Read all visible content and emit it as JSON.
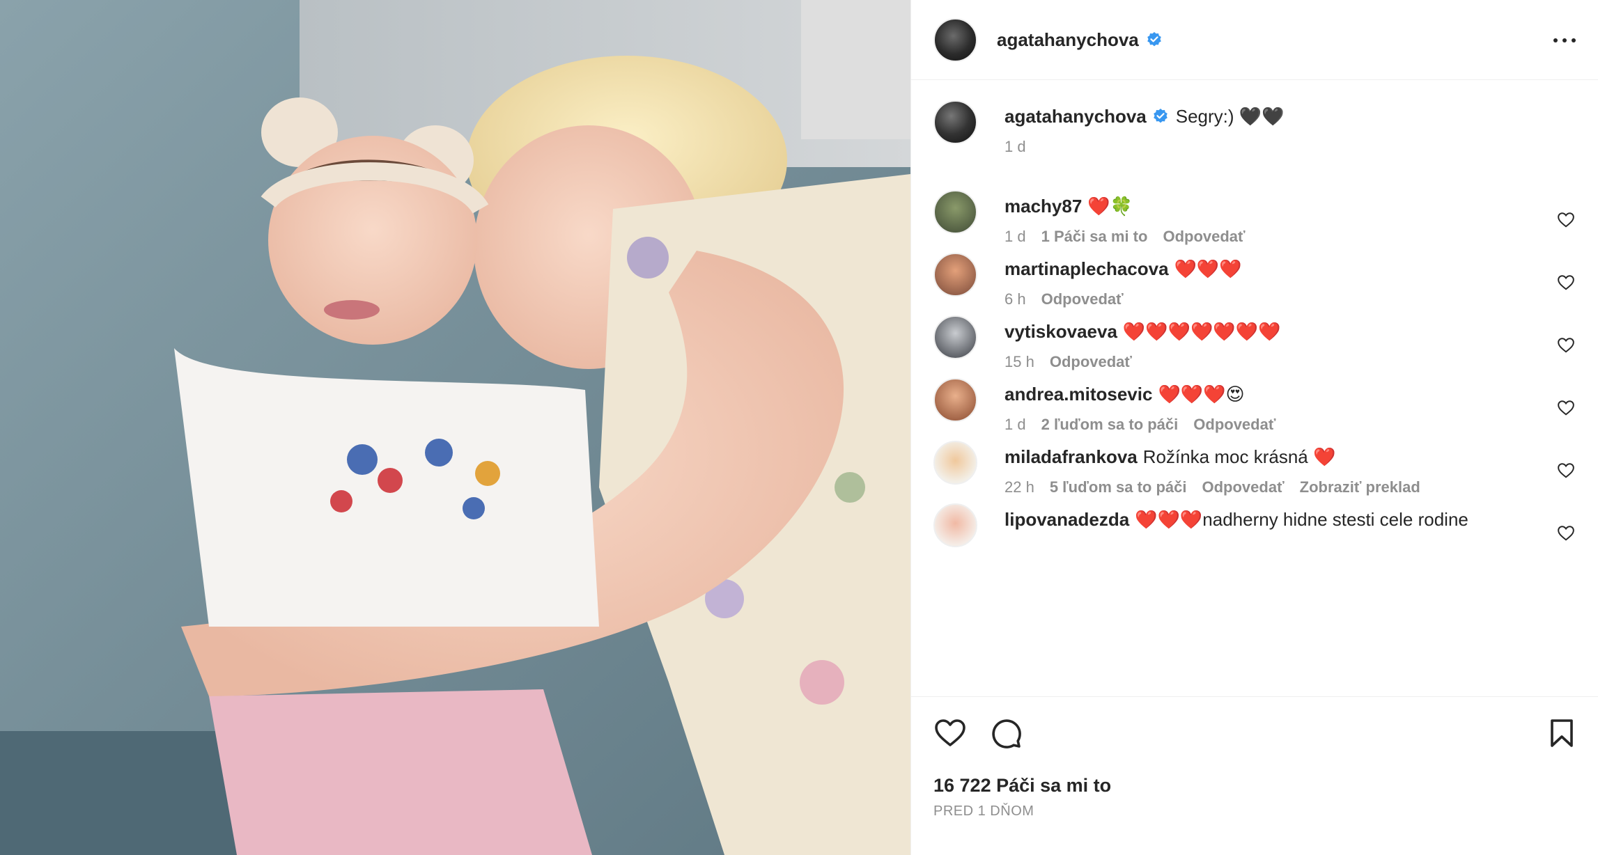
{
  "post": {
    "author": "agatahanychova",
    "more_icon": "more-options-icon"
  },
  "caption": {
    "username": "agatahanychova",
    "text": "Segry:) 🖤🖤",
    "time": "1 d"
  },
  "comments": [
    {
      "username": "machy87",
      "text": "❤️🍀",
      "time": "1 d",
      "likes": "1 Páči sa mi to",
      "reply": "Odpovedať",
      "translate": ""
    },
    {
      "username": "martinaplechacova",
      "text": "❤️❤️❤️",
      "time": "6 h",
      "likes": "",
      "reply": "Odpovedať",
      "translate": ""
    },
    {
      "username": "vytiskovaeva",
      "text": "❤️❤️❤️❤️❤️❤️❤️",
      "time": "15 h",
      "likes": "",
      "reply": "Odpovedať",
      "translate": ""
    },
    {
      "username": "andrea.mitosevic",
      "text": "❤️❤️❤️😍",
      "time": "1 d",
      "likes": "2 ľuďom sa to páči",
      "reply": "Odpovedať",
      "translate": ""
    },
    {
      "username": "miladafrankova",
      "text": "Rožínka moc krásná ❤️",
      "time": "22 h",
      "likes": "5 ľuďom sa to páči",
      "reply": "Odpovedať",
      "translate": "Zobraziť preklad"
    },
    {
      "username": "lipovanadezda",
      "text": "❤️❤️❤️nadherny hidne stesti cele rodine",
      "time": "",
      "likes": "",
      "reply": "",
      "translate": ""
    }
  ],
  "footer": {
    "likes_count": "16 722 Páči sa mi to",
    "posted": "PRED 1 DŇOM"
  },
  "colors": {
    "verified": "#3897f0",
    "text": "#262626",
    "muted": "#8e8e8e",
    "border": "#efefef"
  }
}
